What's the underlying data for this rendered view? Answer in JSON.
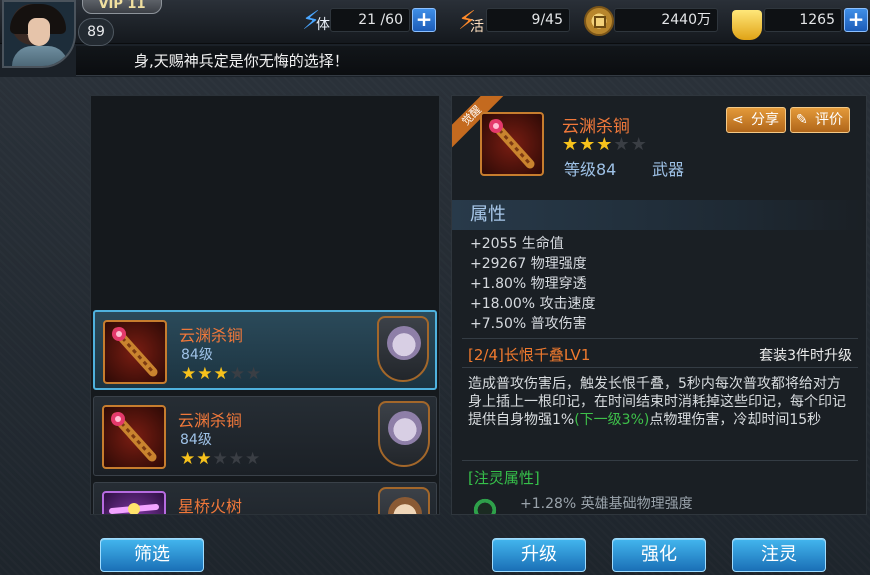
{
  "player": {
    "vip": "VIP 11",
    "level": "89"
  },
  "resources": {
    "stamina": {
      "label": "体",
      "value": "21 /60",
      "icon": "stamina-bolt-icon"
    },
    "vitality": {
      "label": "活",
      "value": "9/45",
      "icon": "vitality-bolt-icon"
    },
    "coins": {
      "value": "2440万",
      "icon": "copper-coin-icon"
    },
    "gold": {
      "value": "1265",
      "icon": "gold-ingot-icon"
    },
    "plus": "+"
  },
  "marquee": "身,天赐神兵定是你无悔的选择！",
  "items": [
    {
      "name": "云渊杀锏",
      "level": "84级",
      "stars": 3,
      "max_stars": 5,
      "hero": "lilac"
    },
    {
      "name": "云渊杀锏",
      "level": "84级",
      "stars": 2,
      "max_stars": 5,
      "hero": "lilac"
    },
    {
      "name": "星桥火树",
      "level": "",
      "stars": 0,
      "max_stars": 5,
      "hero": "beige"
    }
  ],
  "detail": {
    "ribbon": "觉醒",
    "name": "云渊杀锏",
    "stars": 3,
    "max_stars": 5,
    "level": "等级84",
    "type": "武器",
    "share": "分享",
    "review": "评价",
    "attr_header": "属性",
    "stats": [
      "+2055 生命值",
      "+29267 物理强度",
      "+1.80% 物理穿透",
      "+18.00% 攻击速度",
      "+7.50% 普攻伤害"
    ],
    "set_title": "[2/4]长恨千叠LV1",
    "set_condition": "套装3件时升级",
    "set_desc_before": "造成普攻伤害后，触发长恨千叠，5秒内每次普攻都将给对方身上插上一根印记，在时间结束时消耗掉这些印记，每个印记提供自身物强1%",
    "set_desc_green": "(下一级3%)",
    "set_desc_after": "点物理伤害，冷却时间15秒",
    "spirit_title": "[注灵属性]",
    "spirit_stat": "+1.28% 英雄基础物理强度"
  },
  "buttons": {
    "filter": "筛选",
    "upgrade": "升级",
    "enhance": "强化",
    "infuse": "注灵"
  },
  "colors": {
    "accent_blue": "#2f8fd8",
    "item_name_orange": "#f0783a",
    "star_gold": "#f7c21c",
    "green_text": "#3ec04a"
  }
}
